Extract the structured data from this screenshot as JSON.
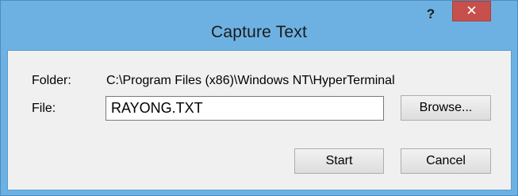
{
  "dialog": {
    "title": "Capture Text",
    "help_glyph": "?",
    "close_glyph": "✕"
  },
  "form": {
    "folder_label": "Folder:",
    "folder_value": "C:\\Program Files (x86)\\Windows NT\\HyperTerminal",
    "file_label": "File:",
    "file_value": "RAYONG.TXT"
  },
  "buttons": {
    "browse": "Browse...",
    "start": "Start",
    "cancel": "Cancel"
  },
  "colors": {
    "titlebar": "#6db1e2",
    "close_button": "#c7504c",
    "client_background": "#f0f0f0"
  },
  "icons": {
    "help": "help-icon",
    "close": "close-icon"
  }
}
